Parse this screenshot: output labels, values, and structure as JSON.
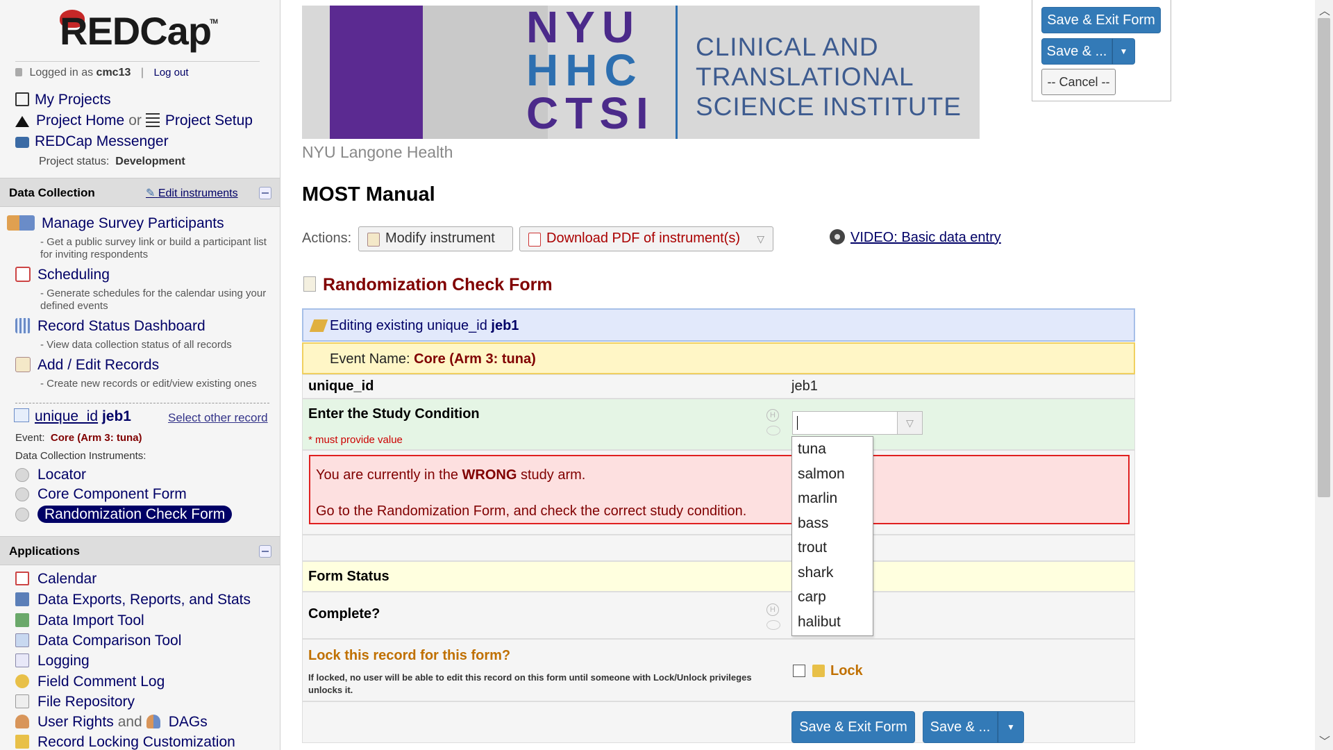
{
  "app": {
    "logo_text": "REDCap",
    "logo_tm": "TM"
  },
  "user": {
    "logged_in_as_label": "Logged in as",
    "username": "cmc13",
    "logout": "Log out"
  },
  "nav": {
    "my_projects": "My Projects",
    "project_home": "Project Home",
    "or": "or",
    "project_setup": "Project Setup",
    "messenger": "REDCap Messenger",
    "project_status_label": "Project status:",
    "project_status_value": "Development"
  },
  "data_collection": {
    "header": "Data Collection",
    "edit_instruments": "Edit instruments",
    "items": [
      {
        "label": "Manage Survey Participants",
        "desc": "- Get a public survey link or build a participant list for inviting respondents"
      },
      {
        "label": "Scheduling",
        "desc": "- Generate schedules for the calendar using your defined events"
      },
      {
        "label": "Record Status Dashboard",
        "desc": "- View data collection status of all records"
      },
      {
        "label": "Add / Edit Records",
        "desc": "- Create new records or edit/view existing ones"
      }
    ],
    "record_prefix": "unique_id",
    "record_id": "jeb1",
    "select_other": "Select other record",
    "event_label": "Event:",
    "event_value": "Core (Arm 3: tuna)",
    "instruments_label": "Data Collection Instruments:",
    "instruments": [
      "Locator",
      "Core Component Form",
      "Randomization Check Form"
    ]
  },
  "applications": {
    "header": "Applications",
    "items": [
      "Calendar",
      "Data Exports, Reports, and Stats",
      "Data Import Tool",
      "Data Comparison Tool",
      "Logging",
      "Field Comment Log",
      "File Repository",
      "User Rights",
      "DAGs",
      "Record Locking Customization"
    ],
    "and": "and"
  },
  "banner": {
    "nyu_line1": "NYU",
    "nyu_line2": "HHC",
    "nyu_line3": "CTSI",
    "ctsi_line1": "CLINICAL AND",
    "ctsi_line2": "TRANSLATIONAL",
    "ctsi_line3": "SCIENCE INSTITUTE",
    "subtitle": "NYU Langone Health"
  },
  "main": {
    "project_title": "MOST Manual",
    "actions_label": "Actions:",
    "modify_instrument": "Modify instrument",
    "download_pdf": "Download PDF of instrument(s)",
    "video": "VIDEO: Basic data entry",
    "form_title": "Randomization Check Form"
  },
  "form": {
    "editing_prefix": "Editing existing unique_id",
    "editing_id": "jeb1",
    "event_name_label": "Event Name:",
    "event_name_value": "Core (Arm 3: tuna)",
    "uid_label": "unique_id",
    "uid_value": "jeb1",
    "study_condition_label": "Enter the Study Condition",
    "must_provide": "* must provide value",
    "study_condition_value": "",
    "dropdown_options": [
      "tuna",
      "salmon",
      "marlin",
      "bass",
      "trout",
      "shark",
      "carp",
      "halibut"
    ],
    "error_line1_pre": "You are currently in the",
    "error_line1_bold": "WRONG",
    "error_line1_post": "study arm.",
    "error_line2": "Go to the Randomization Form, and check the correct study condition.",
    "form_status": "Form Status",
    "complete_label": "Complete?",
    "lock_title": "Lock this record for this form?",
    "lock_desc": "If locked, no user will be able to edit this record on this form until someone with Lock/Unlock privileges unlocks it.",
    "lock_word": "Lock",
    "help_h": "H"
  },
  "buttons": {
    "save_exit": "Save & Exit Form",
    "save_more": "Save & ...",
    "cancel": "-- Cancel --"
  },
  "colors": {
    "accent_blue": "#337ab7",
    "nav_blue": "#000066",
    "error_red": "#e02020",
    "maroon": "#800000"
  }
}
